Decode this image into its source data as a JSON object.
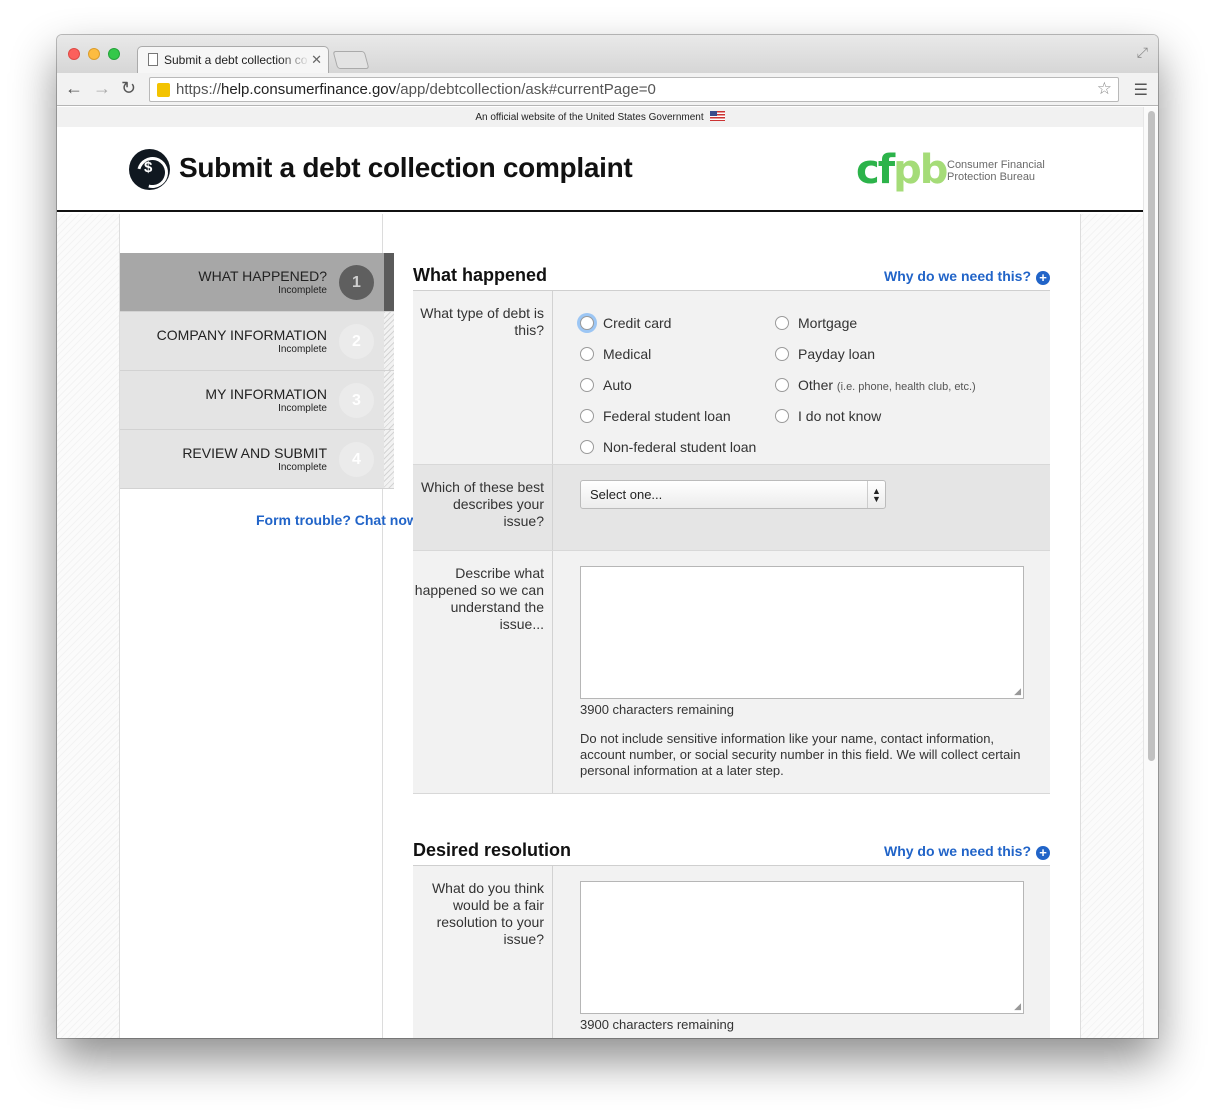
{
  "browser": {
    "tab_title": "Submit a debt collection co",
    "url_scheme": "https://",
    "url_domain": "help.consumerfinance.gov",
    "url_path": "/app/debtcollection/ask#currentPage=0"
  },
  "gov_banner": "An official website of the United States Government",
  "header": {
    "title": "Submit a debt collection complaint",
    "logo_c": "cf",
    "logo_pb": "pb",
    "bureau_line1": "Consumer Financial",
    "bureau_line2": "Protection Bureau"
  },
  "steps": [
    {
      "label": "WHAT HAPPENED?",
      "status": "Incomplete",
      "number": "1"
    },
    {
      "label": "COMPANY INFORMATION",
      "status": "Incomplete",
      "number": "2"
    },
    {
      "label": "MY INFORMATION",
      "status": "Incomplete",
      "number": "3"
    },
    {
      "label": "REVIEW AND SUBMIT",
      "status": "Incomplete",
      "number": "4"
    }
  ],
  "chat_link": "Form trouble? Chat now.",
  "what_happened": {
    "title": "What happened",
    "why_link": "Why do we need this?",
    "debt_type_label": "What type of debt is this?",
    "debt_types": [
      {
        "label": "Credit card",
        "hint": ""
      },
      {
        "label": "Medical",
        "hint": ""
      },
      {
        "label": "Auto",
        "hint": ""
      },
      {
        "label": "Federal student loan",
        "hint": ""
      },
      {
        "label": "Non-federal student loan",
        "hint": ""
      },
      {
        "label": "Mortgage",
        "hint": ""
      },
      {
        "label": "Payday loan",
        "hint": ""
      },
      {
        "label": "Other",
        "hint": "(i.e. phone, health club, etc.)"
      },
      {
        "label": "I do not know",
        "hint": ""
      }
    ],
    "issue_label": "Which of these best describes your issue?",
    "issue_select": "Select one...",
    "describe_label": "Describe what happened so we can understand the issue...",
    "describe_count": "3900 characters remaining",
    "describe_note": "Do not include sensitive information like your name, contact information, account number, or social security number in this field. We will collect certain personal information at a later step."
  },
  "desired_resolution": {
    "title": "Desired resolution",
    "why_link": "Why do we need this?",
    "resolution_label": "What do you think would be a fair resolution to your issue?",
    "resolution_count": "3900 characters remaining"
  }
}
